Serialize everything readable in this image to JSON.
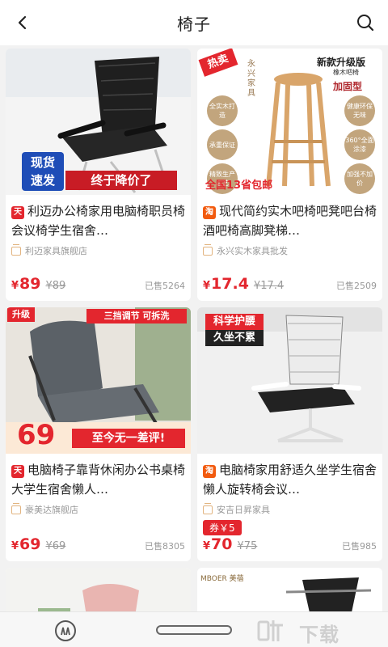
{
  "header": {
    "title": "椅子",
    "back_icon": "chevron-left-icon",
    "search_icon": "search-icon"
  },
  "products": [
    {
      "name": "利迈办公椅家用电脑椅职员椅会议椅学生宿舍…",
      "store_badge": "天",
      "store_type": "tmall",
      "shop": "利迈家具旗舰店",
      "currency": "¥",
      "price": "89",
      "original_price": "¥89",
      "sold": "已售5264",
      "image_banner_1": "现货",
      "image_banner_2": "速发",
      "image_banner_3": "终于降价了"
    },
    {
      "name": "现代简约实木吧椅吧凳吧台椅酒吧椅高脚凳梯…",
      "store_badge": "淘",
      "store_type": "taobao",
      "shop": "永兴实木家具批发",
      "currency": "¥",
      "price": "17.4",
      "original_price": "¥17.4",
      "sold": "已售2509",
      "image_tag_hot": "热卖",
      "image_title": "新款升级版",
      "image_subtitle": "橡木吧椅",
      "image_brand": "永兴家具",
      "image_label": "加固型",
      "image_features": [
        "全实木打造",
        "承重保证",
        "精致生产工艺"
      ],
      "image_features_right": [
        "健康环保无味",
        "360°全面涂漆",
        "加强不加价"
      ],
      "image_footer": "全国13省包邮"
    },
    {
      "name": "电脑椅子靠背休闲办公书桌椅大学生宿舍懒人…",
      "store_badge": "天",
      "store_type": "tmall",
      "shop": "豪美达旗舰店",
      "currency": "¥",
      "price": "69",
      "original_price": "¥69",
      "sold": "已售8305",
      "image_tag": "升级",
      "image_top_label": "三挡调节 可拆洗",
      "image_price": "69",
      "image_slogan": "至今无一差评!"
    },
    {
      "name": "电脑椅家用舒适久坐学生宿舍懒人旋转椅会议…",
      "store_badge": "淘",
      "store_type": "taobao",
      "shop": "安吉日昇家具",
      "coupon": "券￥5",
      "currency": "¥",
      "price": "70",
      "original_price": "¥75",
      "sold": "已售985",
      "image_banner_1": "科学护腰",
      "image_banner_2": "久坐不累"
    }
  ],
  "partial_row": {
    "brand_text": "MBOER 美蓓"
  },
  "bottom_bar": {
    "watermark": "下载"
  },
  "colors": {
    "accent": "#e3262e",
    "tmall": "#e3262e",
    "taobao": "#f25b0f"
  }
}
